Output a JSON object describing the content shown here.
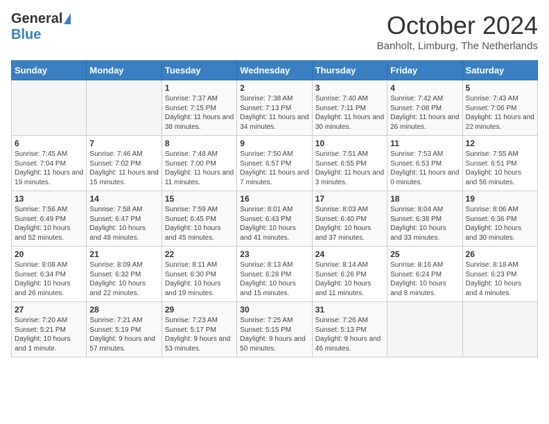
{
  "header": {
    "logo_general": "General",
    "logo_blue": "Blue",
    "month_title": "October 2024",
    "subtitle": "Banholt, Limburg, The Netherlands"
  },
  "days_of_week": [
    "Sunday",
    "Monday",
    "Tuesday",
    "Wednesday",
    "Thursday",
    "Friday",
    "Saturday"
  ],
  "weeks": [
    [
      {
        "day": "",
        "info": ""
      },
      {
        "day": "",
        "info": ""
      },
      {
        "day": "1",
        "info": "Sunrise: 7:37 AM\nSunset: 7:15 PM\nDaylight: 11 hours and 38 minutes."
      },
      {
        "day": "2",
        "info": "Sunrise: 7:38 AM\nSunset: 7:13 PM\nDaylight: 11 hours and 34 minutes."
      },
      {
        "day": "3",
        "info": "Sunrise: 7:40 AM\nSunset: 7:11 PM\nDaylight: 11 hours and 30 minutes."
      },
      {
        "day": "4",
        "info": "Sunrise: 7:42 AM\nSunset: 7:08 PM\nDaylight: 11 hours and 26 minutes."
      },
      {
        "day": "5",
        "info": "Sunrise: 7:43 AM\nSunset: 7:06 PM\nDaylight: 11 hours and 22 minutes."
      }
    ],
    [
      {
        "day": "6",
        "info": "Sunrise: 7:45 AM\nSunset: 7:04 PM\nDaylight: 11 hours and 19 minutes."
      },
      {
        "day": "7",
        "info": "Sunrise: 7:46 AM\nSunset: 7:02 PM\nDaylight: 11 hours and 15 minutes."
      },
      {
        "day": "8",
        "info": "Sunrise: 7:48 AM\nSunset: 7:00 PM\nDaylight: 11 hours and 11 minutes."
      },
      {
        "day": "9",
        "info": "Sunrise: 7:50 AM\nSunset: 6:57 PM\nDaylight: 11 hours and 7 minutes."
      },
      {
        "day": "10",
        "info": "Sunrise: 7:51 AM\nSunset: 6:55 PM\nDaylight: 11 hours and 3 minutes."
      },
      {
        "day": "11",
        "info": "Sunrise: 7:53 AM\nSunset: 6:53 PM\nDaylight: 11 hours and 0 minutes."
      },
      {
        "day": "12",
        "info": "Sunrise: 7:55 AM\nSunset: 6:51 PM\nDaylight: 10 hours and 56 minutes."
      }
    ],
    [
      {
        "day": "13",
        "info": "Sunrise: 7:56 AM\nSunset: 6:49 PM\nDaylight: 10 hours and 52 minutes."
      },
      {
        "day": "14",
        "info": "Sunrise: 7:58 AM\nSunset: 6:47 PM\nDaylight: 10 hours and 48 minutes."
      },
      {
        "day": "15",
        "info": "Sunrise: 7:59 AM\nSunset: 6:45 PM\nDaylight: 10 hours and 45 minutes."
      },
      {
        "day": "16",
        "info": "Sunrise: 8:01 AM\nSunset: 6:43 PM\nDaylight: 10 hours and 41 minutes."
      },
      {
        "day": "17",
        "info": "Sunrise: 8:03 AM\nSunset: 6:40 PM\nDaylight: 10 hours and 37 minutes."
      },
      {
        "day": "18",
        "info": "Sunrise: 8:04 AM\nSunset: 6:38 PM\nDaylight: 10 hours and 33 minutes."
      },
      {
        "day": "19",
        "info": "Sunrise: 8:06 AM\nSunset: 6:36 PM\nDaylight: 10 hours and 30 minutes."
      }
    ],
    [
      {
        "day": "20",
        "info": "Sunrise: 8:08 AM\nSunset: 6:34 PM\nDaylight: 10 hours and 26 minutes."
      },
      {
        "day": "21",
        "info": "Sunrise: 8:09 AM\nSunset: 6:32 PM\nDaylight: 10 hours and 22 minutes."
      },
      {
        "day": "22",
        "info": "Sunrise: 8:11 AM\nSunset: 6:30 PM\nDaylight: 10 hours and 19 minutes."
      },
      {
        "day": "23",
        "info": "Sunrise: 8:13 AM\nSunset: 6:28 PM\nDaylight: 10 hours and 15 minutes."
      },
      {
        "day": "24",
        "info": "Sunrise: 8:14 AM\nSunset: 6:26 PM\nDaylight: 10 hours and 11 minutes."
      },
      {
        "day": "25",
        "info": "Sunrise: 8:16 AM\nSunset: 6:24 PM\nDaylight: 10 hours and 8 minutes."
      },
      {
        "day": "26",
        "info": "Sunrise: 8:18 AM\nSunset: 6:23 PM\nDaylight: 10 hours and 4 minutes."
      }
    ],
    [
      {
        "day": "27",
        "info": "Sunrise: 7:20 AM\nSunset: 5:21 PM\nDaylight: 10 hours and 1 minute."
      },
      {
        "day": "28",
        "info": "Sunrise: 7:21 AM\nSunset: 5:19 PM\nDaylight: 9 hours and 57 minutes."
      },
      {
        "day": "29",
        "info": "Sunrise: 7:23 AM\nSunset: 5:17 PM\nDaylight: 9 hours and 53 minutes."
      },
      {
        "day": "30",
        "info": "Sunrise: 7:25 AM\nSunset: 5:15 PM\nDaylight: 9 hours and 50 minutes."
      },
      {
        "day": "31",
        "info": "Sunrise: 7:26 AM\nSunset: 5:13 PM\nDaylight: 9 hours and 46 minutes."
      },
      {
        "day": "",
        "info": ""
      },
      {
        "day": "",
        "info": ""
      }
    ]
  ]
}
